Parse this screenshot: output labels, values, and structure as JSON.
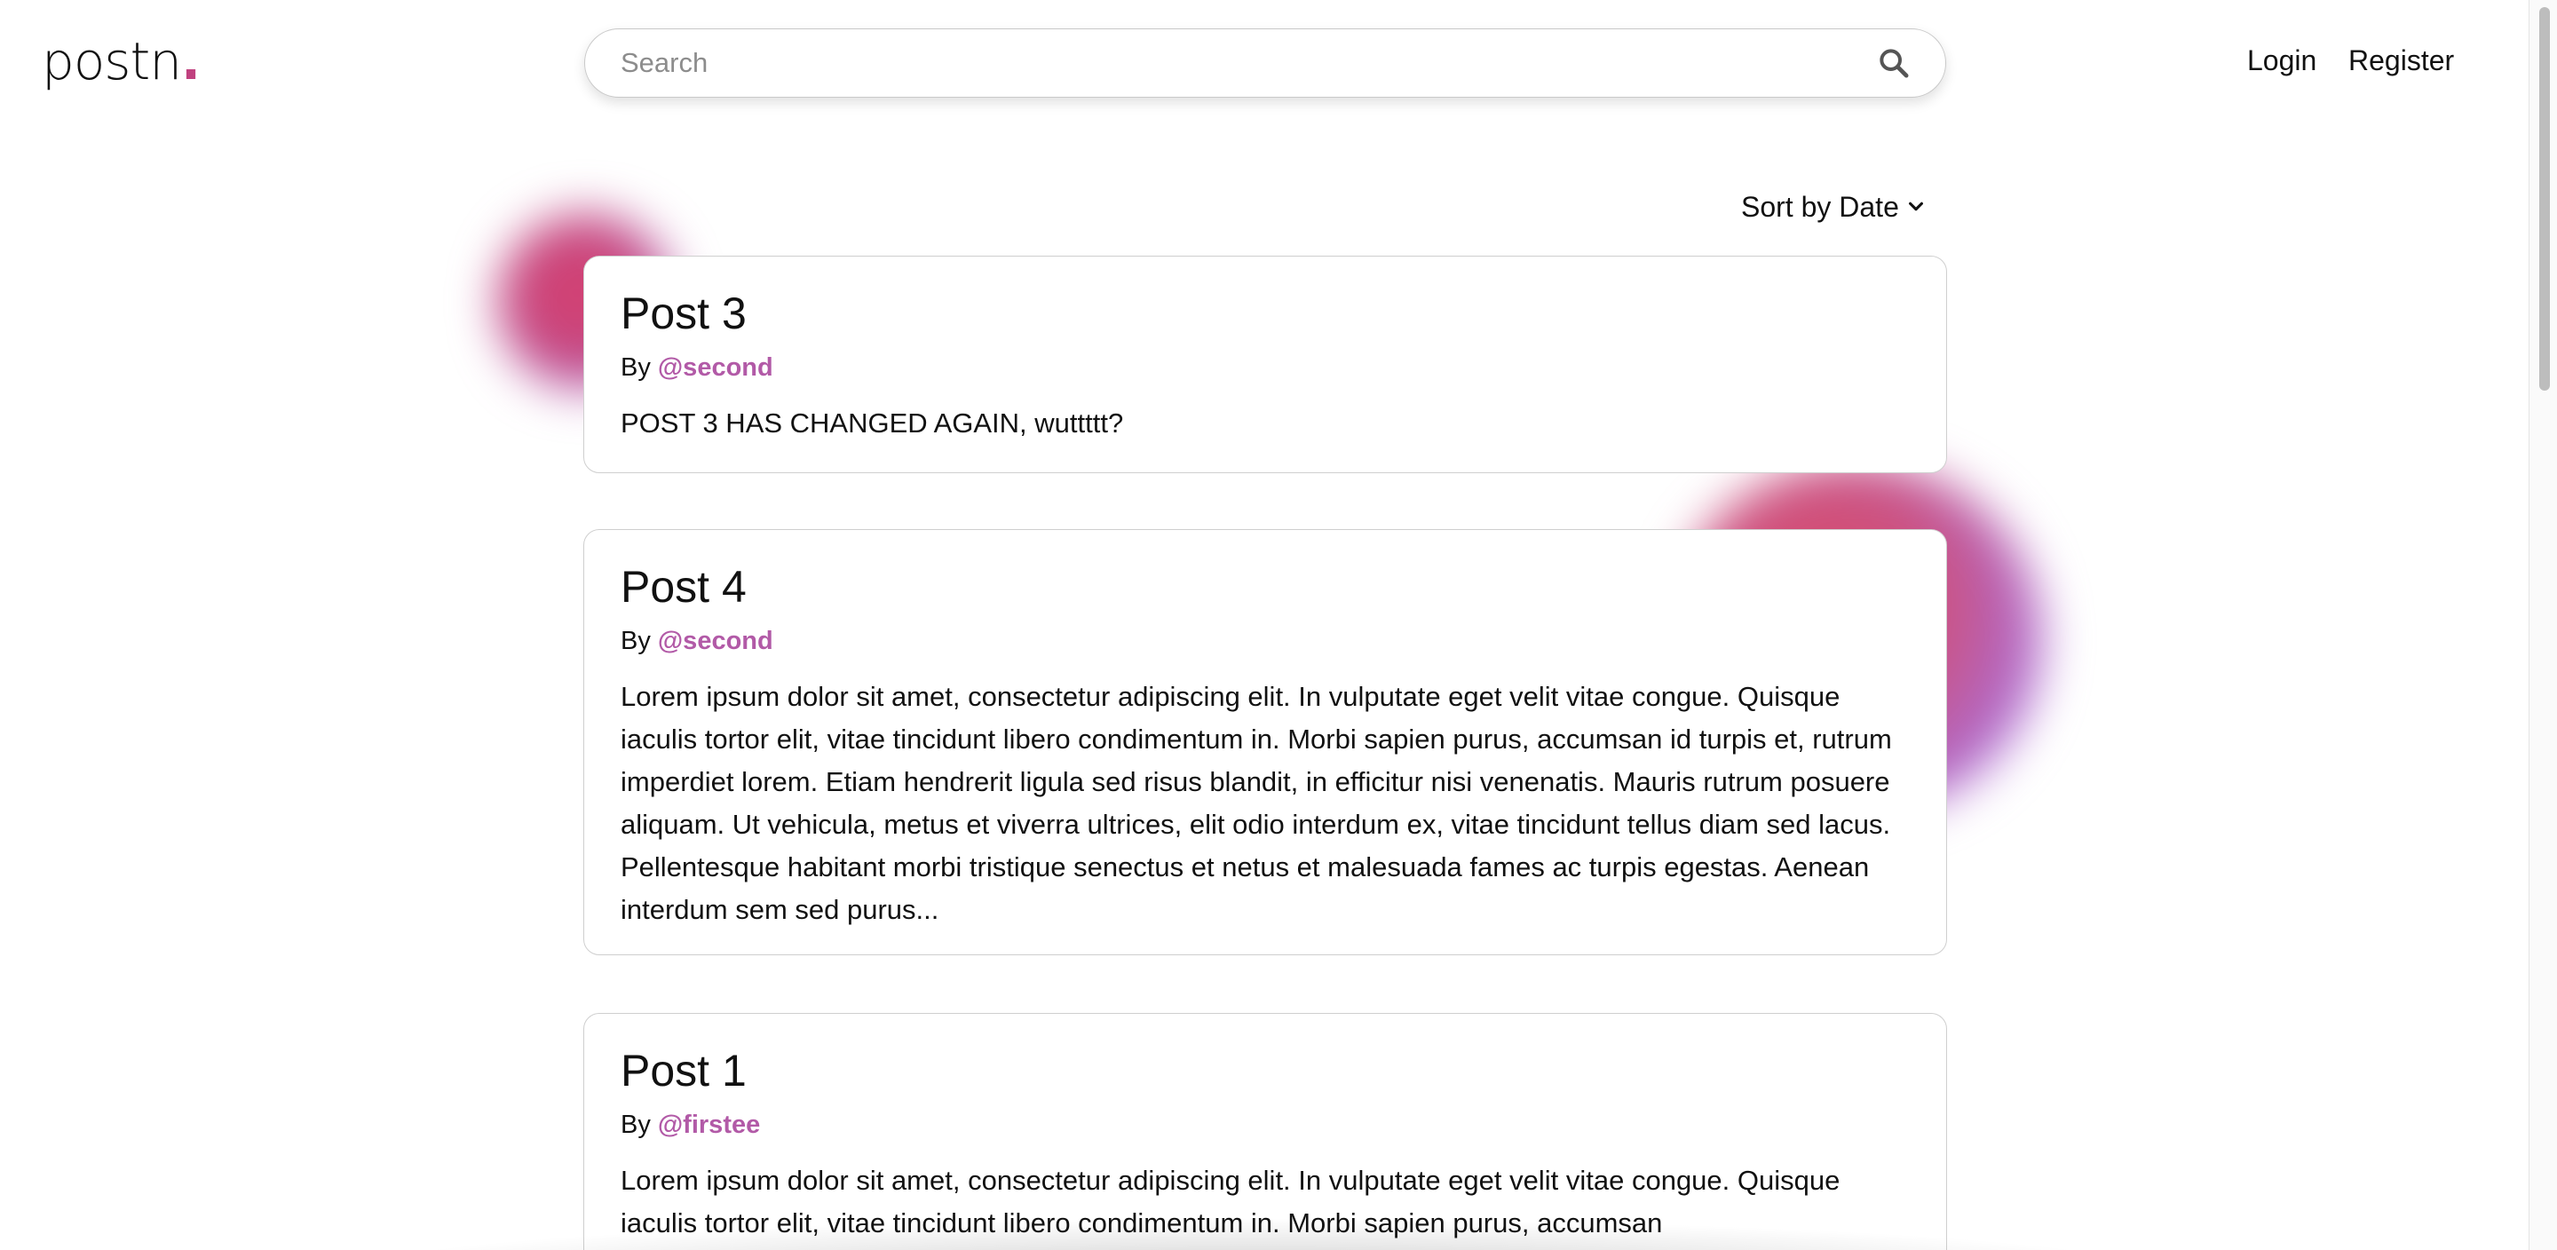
{
  "header": {
    "logo_text": "postn",
    "logo_dot": ".",
    "search": {
      "placeholder": "Search",
      "value": ""
    },
    "nav": {
      "login": "Login",
      "register": "Register"
    }
  },
  "sort": {
    "label": "Sort by Date"
  },
  "posts": [
    {
      "title": "Post 3",
      "by_label": "By",
      "author": "@second",
      "body": "POST 3 HAS CHANGED AGAIN, wuttttt?"
    },
    {
      "title": "Post 4",
      "by_label": "By",
      "author": "@second",
      "body": "Lorem ipsum dolor sit amet, consectetur adipiscing elit. In vulputate eget velit vitae congue. Quisque iaculis tortor elit, vitae tincidunt libero condimentum in. Morbi sapien purus, accumsan id turpis et, rutrum imperdiet lorem. Etiam hendrerit ligula sed risus blandit, in efficitur nisi venenatis. Mauris rutrum posuere aliquam. Ut vehicula, metus et viverra ultrices, elit odio interdum ex, vitae tincidunt tellus diam sed lacus. Pellentesque habitant morbi tristique senectus et netus et malesuada fames ac turpis egestas. Aenean interdum sem sed purus..."
    },
    {
      "title": "Post 1",
      "by_label": "By",
      "author": "@firstee",
      "body": "Lorem ipsum dolor sit amet, consectetur adipiscing elit. In vulputate eget velit vitae congue. Quisque iaculis tortor elit, vitae tincidunt libero condimentum in. Morbi sapien purus, accumsan"
    }
  ],
  "icons": {
    "search": "search-icon",
    "sort_chevron": "chevron-down-icon"
  },
  "colors": {
    "accent": "#c0417f",
    "author_link": "#b25aa7",
    "blob_pink": "#d63e6e",
    "blob_purple": "#a76fd0"
  }
}
